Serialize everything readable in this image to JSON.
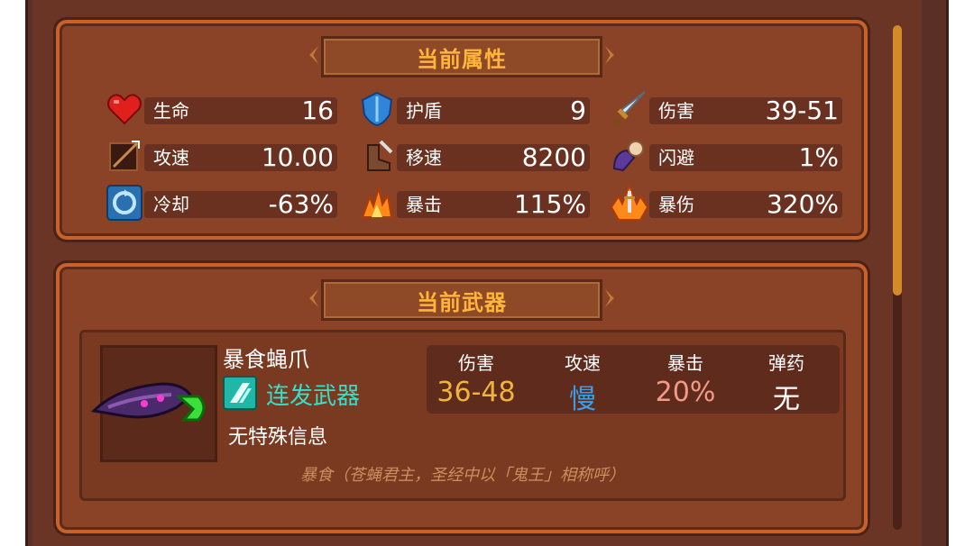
{
  "attributes": {
    "title": "当前属性",
    "stats": [
      {
        "icon": "heart-icon",
        "label": "生命",
        "value": "16"
      },
      {
        "icon": "shield-icon",
        "label": "护盾",
        "value": "9"
      },
      {
        "icon": "sword-icon",
        "label": "伤害",
        "value": "39-51"
      },
      {
        "icon": "attack-speed-icon",
        "label": "攻速",
        "value": "10.00"
      },
      {
        "icon": "boot-icon",
        "label": "移速",
        "value": "8200"
      },
      {
        "icon": "dodge-icon",
        "label": "闪避",
        "value": "1%"
      },
      {
        "icon": "cooldown-icon",
        "label": "冷却",
        "value": "-63%"
      },
      {
        "icon": "crit-icon",
        "label": "暴击",
        "value": "115%"
      },
      {
        "icon": "crit-damage-icon",
        "label": "暴伤",
        "value": "320%"
      }
    ]
  },
  "weapon": {
    "title": "当前武器",
    "name": "暴食蝇爪",
    "type": "连发武器",
    "info": "无特殊信息",
    "description": "暴食（苍蝇君主，圣经中以「鬼王」相称呼）",
    "stats": [
      {
        "label": "伤害",
        "value": "36-48",
        "color": "#f0b43c"
      },
      {
        "label": "攻速",
        "value": "慢",
        "color": "#3a9ee8"
      },
      {
        "label": "暴击",
        "value": "20%",
        "color": "#f29a86"
      },
      {
        "label": "弹药",
        "value": "无",
        "color": "#ffffff"
      }
    ]
  }
}
